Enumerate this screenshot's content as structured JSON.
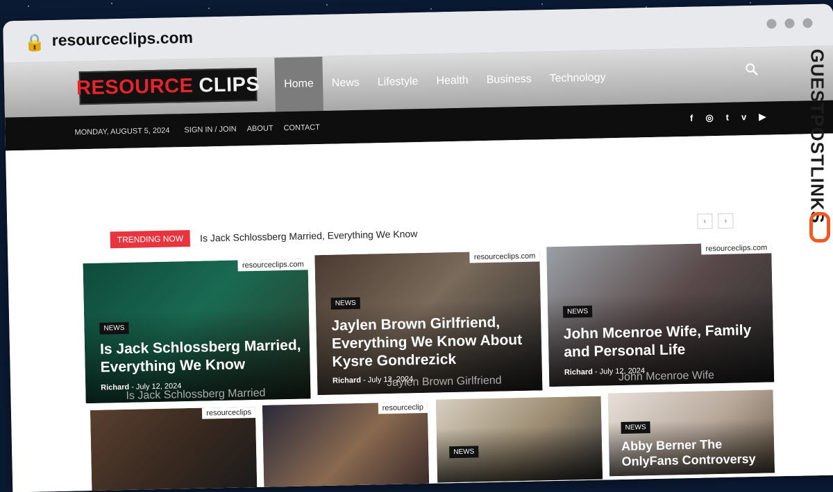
{
  "browser": {
    "url": "resourceclips.com"
  },
  "site": {
    "logo_red": "RESOURCE",
    "logo_white": "CLIPS",
    "nav": [
      "Home",
      "News",
      "Lifestyle",
      "Health",
      "Business",
      "Technology"
    ],
    "date": "MONDAY, AUGUST 5, 2024",
    "toplinks": [
      "SIGN IN / JOIN",
      "ABOUT",
      "CONTACT"
    ],
    "social": [
      "f",
      "◎",
      "t",
      "v",
      "▶"
    ]
  },
  "trending": {
    "label": "TRENDING NOW",
    "text": "Is Jack Schlossberg Married, Everything We Know"
  },
  "cards": [
    {
      "watermark": "resourceclips.com",
      "category": "NEWS",
      "title_line1": "Is Jack Schlossberg Married,",
      "title_line2": "Everything We Know",
      "author": "Richard",
      "date": "July 12, 2024",
      "caption": "Is Jack Schlossberg Married"
    },
    {
      "watermark": "resourceclips.com",
      "category": "NEWS",
      "title_line1": "Jaylen Brown Girlfriend,",
      "title_line2": "Everything We Know About",
      "title_line3": "Kysre Gondrezick",
      "author": "Richard",
      "date": "July 12, 2024",
      "caption": "Jaylen Brown Girlfriend"
    },
    {
      "watermark": "resourceclips.com",
      "category": "NEWS",
      "title_line1": "John Mcenroe Wife, Family",
      "title_line2": "and Personal Life",
      "author": "Richard",
      "date": "July 12, 2024",
      "caption": "John Mcenroe Wife"
    },
    {
      "watermark": "resourceclips"
    },
    {
      "watermark": "resourceclip"
    },
    {
      "category": "NEWS"
    },
    {
      "category": "NEWS",
      "title_line1": "Abby Berner The",
      "title_line2": "OnlyFans Controversy"
    }
  ],
  "side_brand": "GUESTPOSTLINKS",
  "colors": {
    "accent_red": "#e7343f",
    "brand_orange": "#f15a24"
  }
}
